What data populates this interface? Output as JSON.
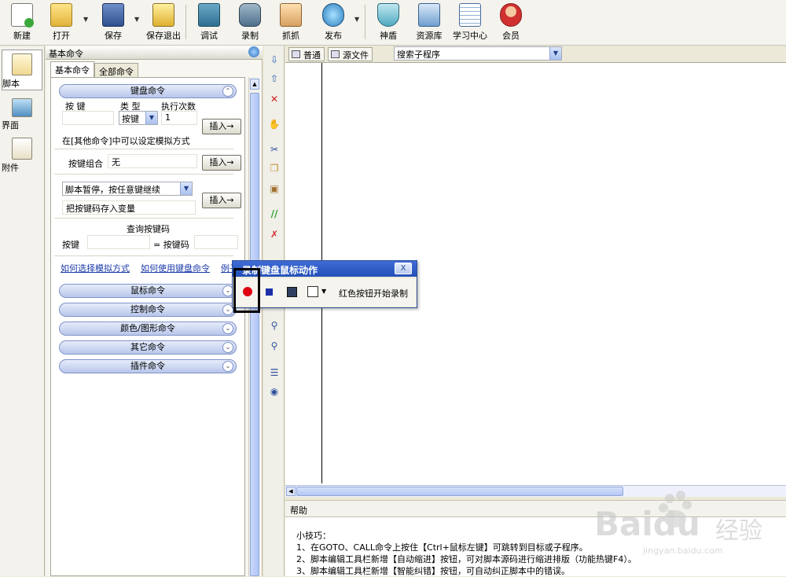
{
  "toolbar": {
    "items": [
      {
        "label": "新建",
        "icon": "new-script-icon"
      },
      {
        "label": "打开",
        "icon": "open-folder-icon"
      },
      {
        "label": "保存",
        "icon": "save-disk-icon"
      },
      {
        "label": "保存退出",
        "icon": "save-exit-icon"
      },
      {
        "label": "调试",
        "icon": "debug-icon"
      },
      {
        "label": "录制",
        "icon": "record-camera-icon"
      },
      {
        "label": "抓抓",
        "icon": "grab-hand-icon"
      },
      {
        "label": "发布",
        "icon": "publish-globe-icon"
      },
      {
        "label": "神盾",
        "icon": "shield-icon"
      },
      {
        "label": "资源库",
        "icon": "resource-library-icon"
      },
      {
        "label": "学习中心",
        "icon": "learning-center-icon"
      },
      {
        "label": "会员",
        "icon": "member-avatar-icon"
      }
    ]
  },
  "sidenav": {
    "items": [
      {
        "label": "脚本",
        "icon": "script-icon"
      },
      {
        "label": "界面",
        "icon": "ui-icon"
      },
      {
        "label": "附件",
        "icon": "attachment-icon"
      }
    ]
  },
  "cmdpanel": {
    "title": "基本命令",
    "tabs": [
      "基本命令",
      "全部命令"
    ],
    "keyboard": {
      "header": "键盘命令",
      "key_label": "按 键",
      "type_label": "类 型",
      "times_label": "执行次数",
      "type_value": "按键",
      "times_value": "1",
      "insert": "插入→",
      "mode_note": "在[其他命令]中可以设定模拟方式",
      "combo_label": "按键组合",
      "combo_value": "无",
      "pause_option": "脚本暂停，按任意键继续",
      "store_label": "把按键码存入变量",
      "query_title": "查询按键码",
      "query_key_label": "按键",
      "query_code_label": "= 按键码",
      "links": [
        "如何选择模拟方式",
        "如何使用键盘命令",
        "例子"
      ]
    },
    "sections": [
      "鼠标命令",
      "控制命令",
      "颜色/图形命令",
      "其它命令",
      "插件命令"
    ]
  },
  "editor": {
    "tabs": [
      "普通",
      "源文件"
    ],
    "search_placeholder": "搜索子程序"
  },
  "help": {
    "title": "帮助",
    "heading": "小技巧：",
    "tips": [
      "1、在GOTO、CALL命令上按住【Ctrl+鼠标左键】可跳转到目标或子程序。",
      "2、脚本编辑工具栏新增【自动缩进】按钮，可对脚本源码进行缩进排版（功能热键F4）。",
      "3、脚本编辑工具栏新增【智能纠错】按钮，可自动纠正脚本中的错误。"
    ]
  },
  "popup": {
    "title": "录制键盘鼠标动作",
    "close": "X",
    "hint": "红色按钮开始录制"
  },
  "watermark": {
    "brand": "Baidu",
    "brand_cn": "经验",
    "url": "jingyan.baidu.com"
  },
  "colors": {
    "record": "#e00010",
    "stop": "#1c2ea8",
    "popup_title": "#2350b8",
    "section_header": "#b8c6ea"
  }
}
